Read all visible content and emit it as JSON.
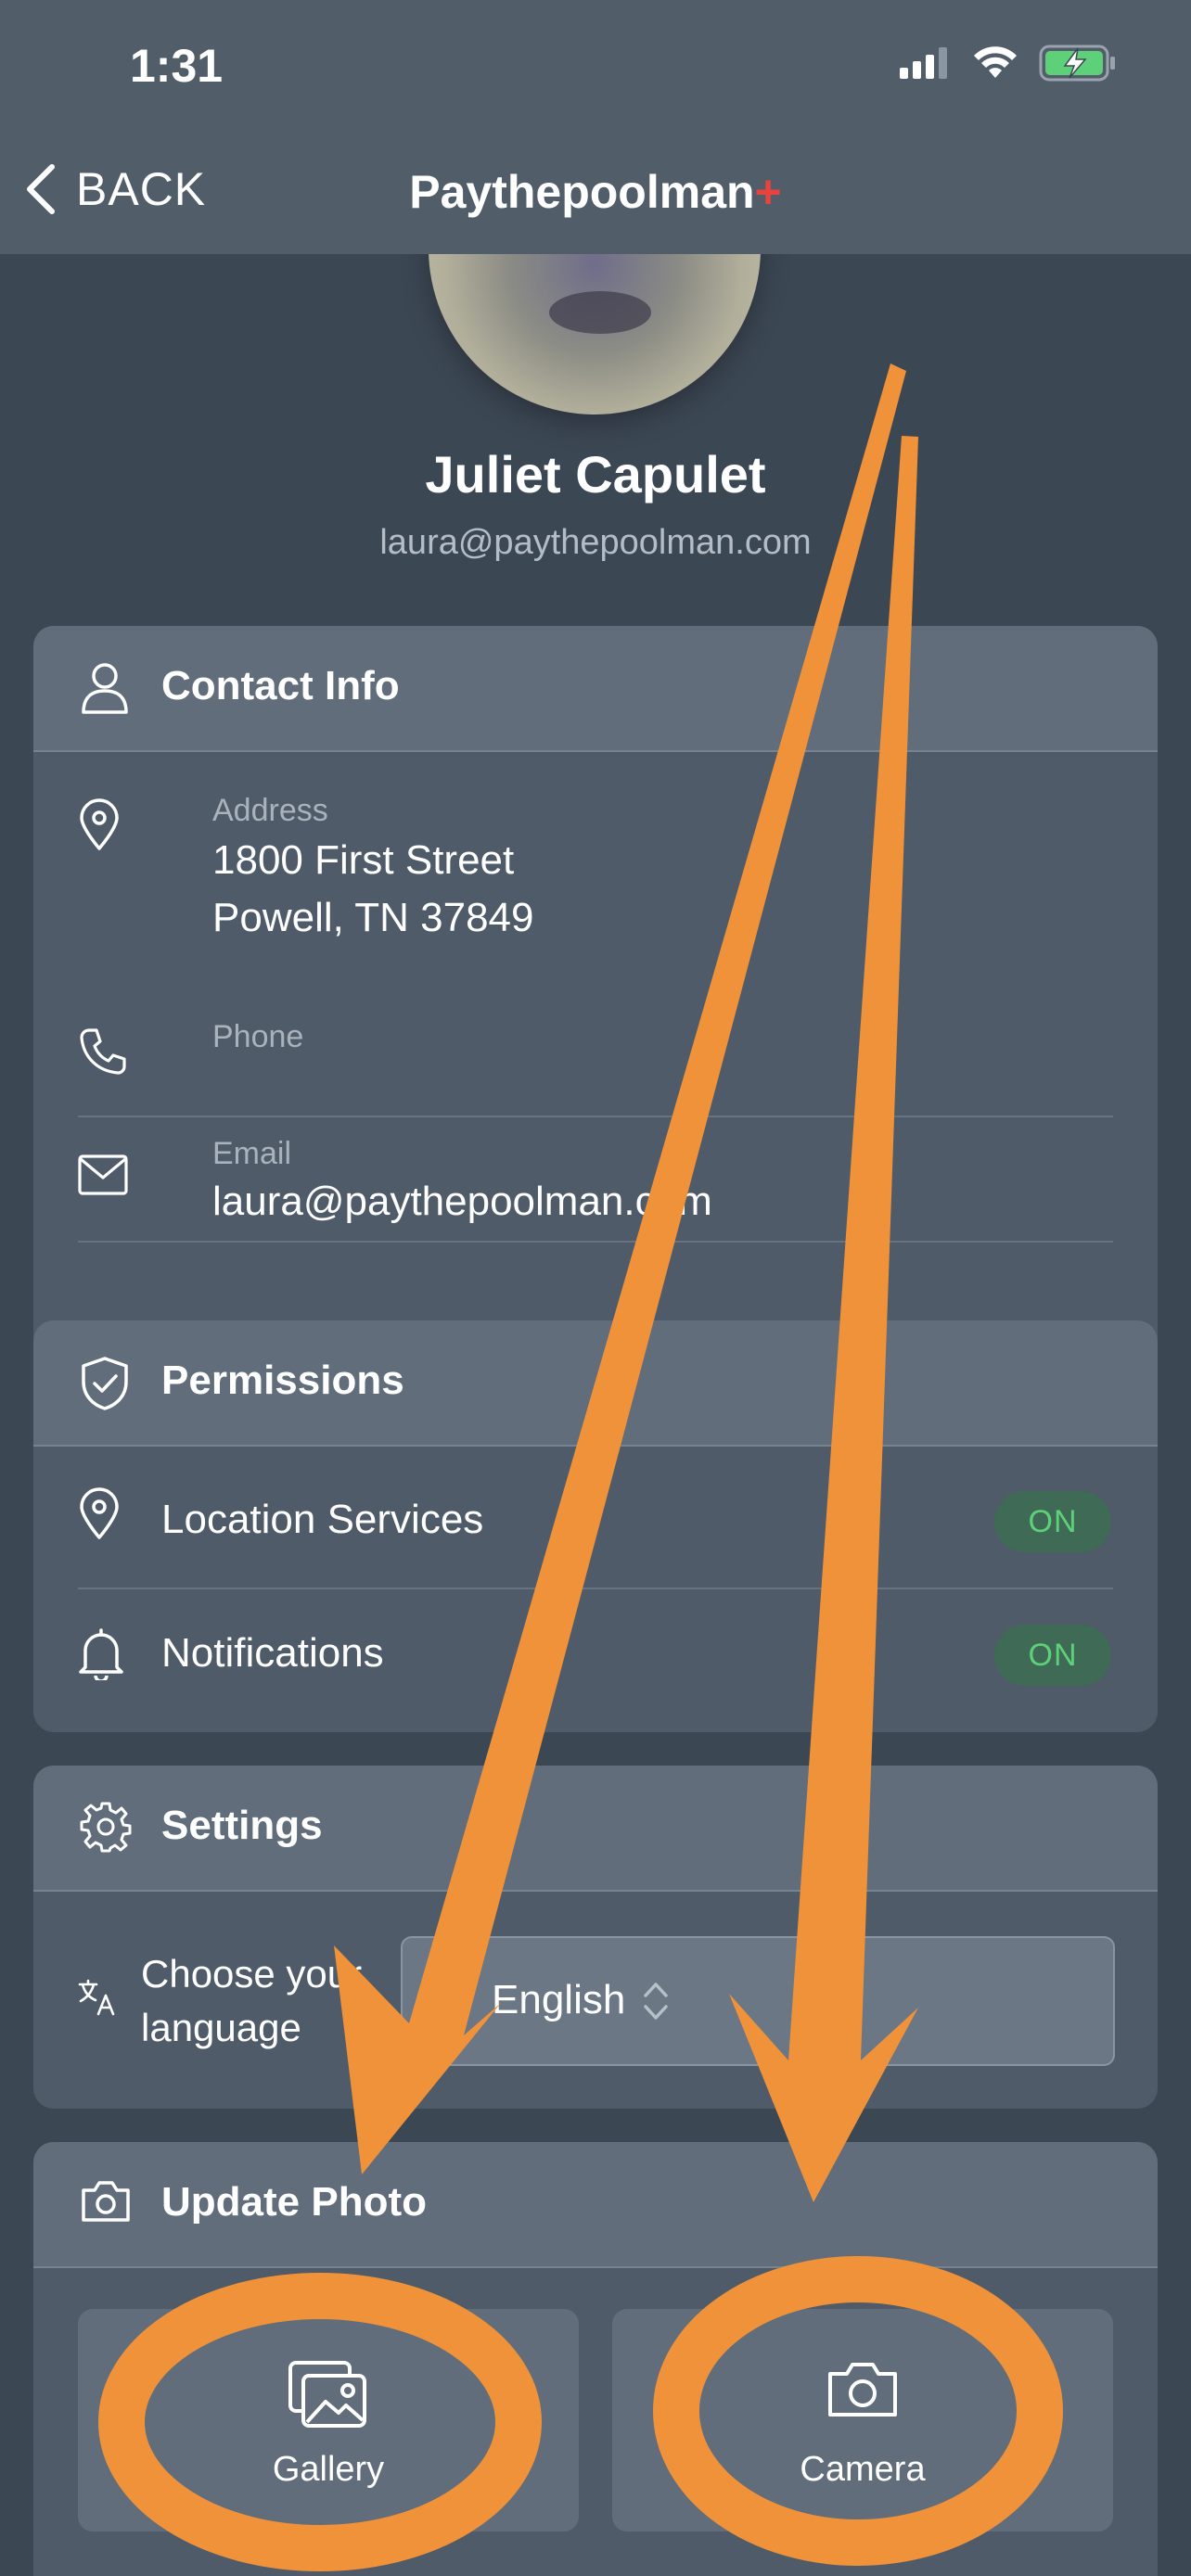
{
  "status_bar": {
    "time": "1:31"
  },
  "nav": {
    "back_label": "BACK",
    "app_title": "Paythepoolman",
    "app_title_accent": "+"
  },
  "profile": {
    "name": "Juliet Capulet",
    "email": "laura@paythepoolman.com"
  },
  "contact": {
    "title": "Contact Info",
    "address_label": "Address",
    "address_line1": "1800 First Street",
    "address_line2": "Powell, TN 37849",
    "phone_label": "Phone",
    "email_label": "Email",
    "email_value": "laura@paythepoolman.com"
  },
  "permissions": {
    "title": "Permissions",
    "location_label": "Location Services",
    "location_state": "ON",
    "notifications_label": "Notifications",
    "notifications_state": "ON"
  },
  "settings": {
    "title": "Settings",
    "language_label": "Choose your language",
    "language_value": "English"
  },
  "update_photo": {
    "title": "Update Photo",
    "gallery_label": "Gallery",
    "camera_label": "Camera"
  },
  "colors": {
    "accent": "#e8433c",
    "annotation": "#f0923a",
    "toggle_on": "#5fd07a"
  }
}
